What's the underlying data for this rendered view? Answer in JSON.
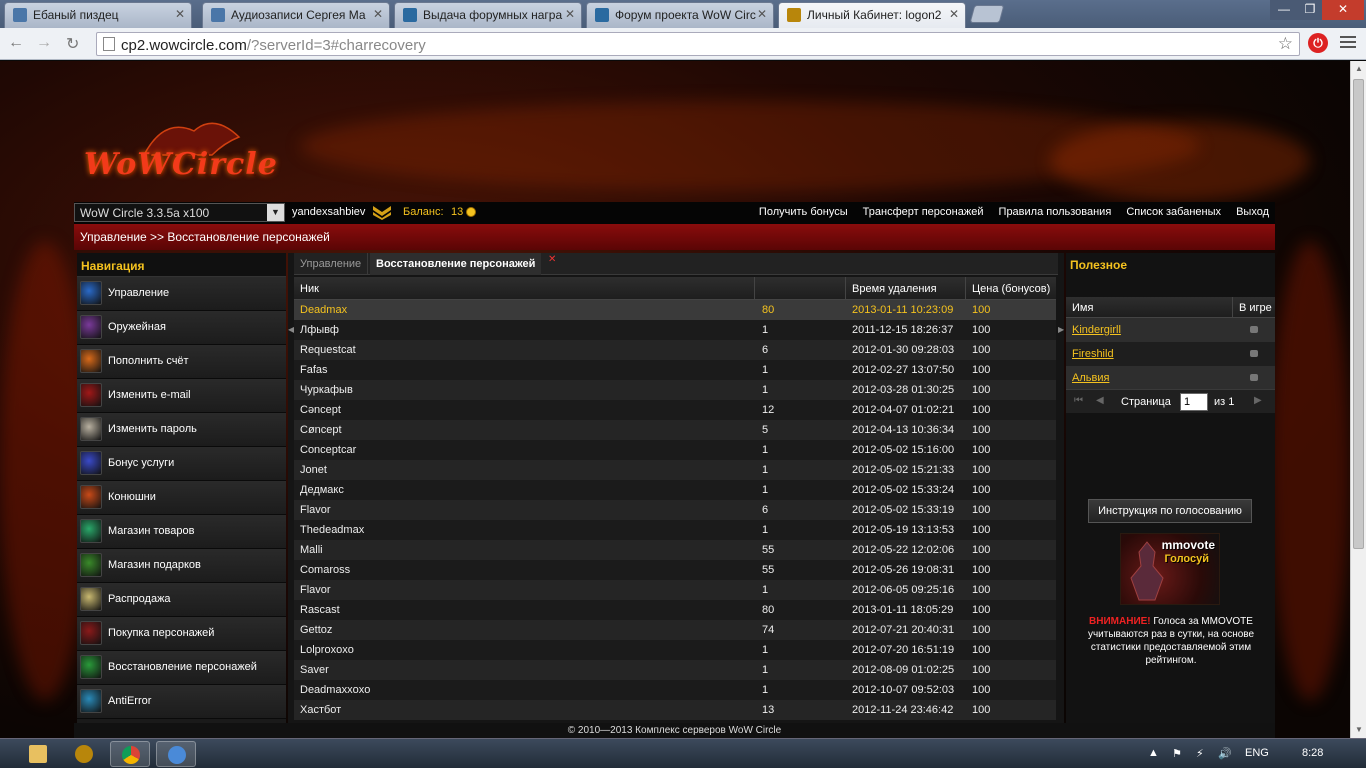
{
  "browser": {
    "tabs": [
      {
        "title": "Ебаный пиздец",
        "favicon": "vk-icon",
        "color": "#4a76a8",
        "active": false
      },
      {
        "title": "Аудиозаписи Сергея Ма",
        "favicon": "vk-icon",
        "color": "#4a76a8",
        "active": false
      },
      {
        "title": "Выдача форумных награ",
        "favicon": "forum-icon",
        "color": "#2a6aa0",
        "active": false
      },
      {
        "title": "Форум проекта WoW Circ",
        "favicon": "forum-icon",
        "color": "#2a6aa0",
        "active": false
      },
      {
        "title": "Личный Кабинет: logon2",
        "favicon": "wow-icon",
        "color": "#b8860b",
        "active": true
      }
    ],
    "url_host": "cp2.wowcircle.com",
    "url_path": "/?serverId=3#charrecovery"
  },
  "site": {
    "logo_text": "WoWCircle",
    "server_select": "WoW Circle 3.3.5a x100",
    "username": "yandexsahbiev",
    "balance_label": "Баланс:",
    "balance_value": "13",
    "top_links": [
      "Получить бонусы",
      "Трансферт персонажей",
      "Правила пользования",
      "Список забаненых",
      "Выход"
    ],
    "breadcrumb": "Управление >> Восстановление персонажей",
    "footer": "© 2010—2013 Комплекс серверов WoW Circle"
  },
  "nav": {
    "title": "Навигация",
    "items": [
      {
        "label": "Управление",
        "icon": "management-icon",
        "color": "#2a6ac8"
      },
      {
        "label": "Оружейная",
        "icon": "armory-icon",
        "color": "#7a3a9a"
      },
      {
        "label": "Пополнить счёт",
        "icon": "deposit-icon",
        "color": "#d86a1a"
      },
      {
        "label": "Изменить e-mail",
        "icon": "email-icon",
        "color": "#a01818"
      },
      {
        "label": "Изменить пароль",
        "icon": "password-icon",
        "color": "#b8b0a0"
      },
      {
        "label": "Бонус услуги",
        "icon": "bonus-icon",
        "color": "#3a4ac8"
      },
      {
        "label": "Конюшни",
        "icon": "stables-icon",
        "color": "#c84a18"
      },
      {
        "label": "Магазин товаров",
        "icon": "goods-shop-icon",
        "color": "#2aa86a"
      },
      {
        "label": "Магазин подарков",
        "icon": "gift-shop-icon",
        "color": "#3a8a2a"
      },
      {
        "label": "Распродажа",
        "icon": "sale-icon",
        "color": "#c8b870"
      },
      {
        "label": "Покупка персонажей",
        "icon": "buy-character-icon",
        "color": "#8a1a1a"
      },
      {
        "label": "Восстановление персонажей",
        "icon": "restore-character-icon",
        "color": "#2a9a3a"
      },
      {
        "label": "AntiError",
        "icon": "antierror-icon",
        "color": "#2a8ab8"
      }
    ]
  },
  "main": {
    "tabs": [
      "Управление",
      "Восстановление персонажей"
    ],
    "columns": [
      "Ник",
      "",
      "Время удаления",
      "Цена (бонусов)"
    ],
    "rows": [
      [
        "Deadmax",
        "80",
        "2013-01-11 10:23:09",
        "100"
      ],
      [
        "Лфывф",
        "1",
        "2011-12-15 18:26:37",
        "100"
      ],
      [
        "Requestcat",
        "6",
        "2012-01-30 09:28:03",
        "100"
      ],
      [
        "Fafas",
        "1",
        "2012-02-27 13:07:50",
        "100"
      ],
      [
        "Чуркафыв",
        "1",
        "2012-03-28 01:30:25",
        "100"
      ],
      [
        "Cəncept",
        "12",
        "2012-04-07 01:02:21",
        "100"
      ],
      [
        "Cøncept",
        "5",
        "2012-04-13 10:36:34",
        "100"
      ],
      [
        "Conceptcar",
        "1",
        "2012-05-02 15:16:00",
        "100"
      ],
      [
        "Jonet",
        "1",
        "2012-05-02 15:21:33",
        "100"
      ],
      [
        "Дедмакс",
        "1",
        "2012-05-02 15:33:24",
        "100"
      ],
      [
        "Flavor",
        "6",
        "2012-05-02 15:33:19",
        "100"
      ],
      [
        "Thedeadmax",
        "1",
        "2012-05-19 13:13:53",
        "100"
      ],
      [
        "Malli",
        "55",
        "2012-05-22 12:02:06",
        "100"
      ],
      [
        "Comaross",
        "55",
        "2012-05-26 19:08:31",
        "100"
      ],
      [
        "Flavor",
        "1",
        "2012-06-05 09:25:16",
        "100"
      ],
      [
        "Rascast",
        "80",
        "2013-01-11 18:05:29",
        "100"
      ],
      [
        "Gettoz",
        "74",
        "2012-07-21 20:40:31",
        "100"
      ],
      [
        "Lolproxoxo",
        "1",
        "2012-07-20 16:51:19",
        "100"
      ],
      [
        "Saver",
        "1",
        "2012-08-09 01:02:25",
        "100"
      ],
      [
        "Deadmaxxoxo",
        "1",
        "2012-10-07 09:52:03",
        "100"
      ],
      [
        "Хастбот",
        "13",
        "2012-11-24 23:46:42",
        "100"
      ]
    ]
  },
  "useful": {
    "title": "Полезное",
    "col_name": "Имя",
    "col_ingame": "В игре",
    "players": [
      "Kindergirll",
      "Fireshild",
      "Альвия"
    ],
    "pager_label": "Страница",
    "pager_value": "1",
    "pager_of": "из 1",
    "vote_button": "Инструкция по голосованию",
    "banner_top": "mmovote",
    "banner_bottom": "Голосуй",
    "warning": "ВНИМАНИЕ!",
    "note": "Голоса за MMOVOTE учитываются раз в сутки, на основе статистики предоставляемой этим рейтингом."
  },
  "taskbar": {
    "lang": "ENG",
    "time": "8:28"
  }
}
